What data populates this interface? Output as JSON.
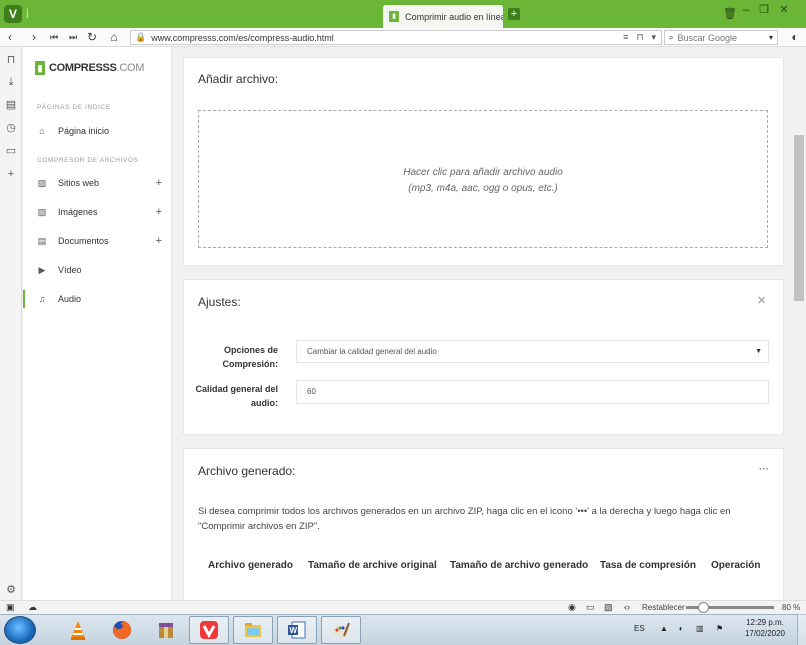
{
  "browser": {
    "tab_title": "Comprimir audio en línea -",
    "url": "www.compresss.com/es/compress-audio.html",
    "search_placeholder": "Buscar Google"
  },
  "site": {
    "logo_main": "COMPRESSS",
    "logo_suffix": ".COM",
    "section1": "PÁGINAS DE INDICE",
    "home": "Página inicio",
    "section2": "COMPRESOR DE ARCHIVOS",
    "items": [
      {
        "label": "Sitios web",
        "icon": "image-icon",
        "expandable": true
      },
      {
        "label": "Imágenes",
        "icon": "image-icon",
        "expandable": true
      },
      {
        "label": "Documentos",
        "icon": "document-icon",
        "expandable": true
      },
      {
        "label": "Vídeo",
        "icon": "video-icon",
        "expandable": false
      },
      {
        "label": "Audio",
        "icon": "audio-icon",
        "expandable": false,
        "active": true
      }
    ]
  },
  "add": {
    "title": "Añadir archivo:",
    "drop_line1": "Hacer clic para añadir archivo audio",
    "drop_line2": "(mp3, m4a, aac, ogg o opus, etc.)"
  },
  "settings": {
    "title": "Ajustes:",
    "opt_label_1": "Opciones de",
    "opt_label_2": "Compresión:",
    "opt_value": "Cambiar la calidad general del audio",
    "quality_label_1": "Calidad general del",
    "quality_label_2": "audio:",
    "quality_value": "60"
  },
  "generated": {
    "title": "Archivo generado:",
    "menu": "···",
    "text_1": "Si desea comprimir todos los archivos generados en un archivo ZIP, haga clic en el icono '•••' a la derecha y luego haga clic en",
    "text_2": "\"Comprimir archivos en ZIP\".",
    "columns": [
      "Archivo generado",
      "Tamaño de archive original",
      "Tamaño de archivo generado",
      "Tasa de compresión",
      "Operación"
    ]
  },
  "statusbar": {
    "reset": "Restablecer",
    "zoom": "80 %"
  },
  "taskbar": {
    "lang": "ES",
    "time": "12:29 p.m.",
    "date": "17/02/2020"
  }
}
